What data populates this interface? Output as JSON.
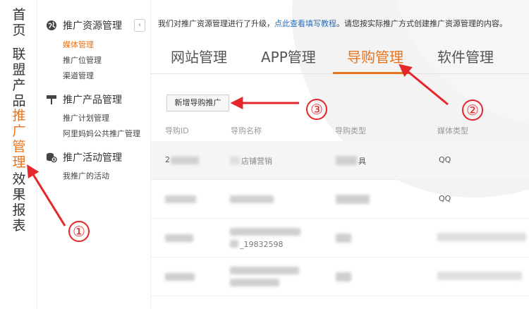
{
  "left_nav": {
    "items": [
      {
        "label": "首页",
        "active": false
      },
      {
        "label": "联盟产品",
        "active": false
      },
      {
        "label": "推广管理",
        "active": true
      },
      {
        "label": "效果报表",
        "active": false
      }
    ]
  },
  "sidebar": {
    "collapse_glyph": "‹",
    "groups": [
      {
        "icon": "globe-icon",
        "title": "推广资源管理",
        "items": [
          "媒体管理",
          "推广位管理",
          "渠道管理"
        ]
      },
      {
        "icon": "signpost-icon",
        "title": "推广产品管理",
        "items": [
          "推广计划管理",
          "阿里妈妈公共推广管理"
        ]
      },
      {
        "icon": "coins-icon",
        "title": "推广活动管理",
        "items": [
          "我推广的活动"
        ]
      }
    ]
  },
  "main": {
    "notice_prefix": "我们对推广资源管理进行了升级，",
    "notice_link": "点此查看填写教程",
    "notice_suffix": "。请您按实际推广方式创建推广资源管理的内容。",
    "tabs": [
      "网站管理",
      "APP管理",
      "导购管理",
      "软件管理"
    ],
    "active_tab": "导购管理",
    "add_button": "新增导购推广",
    "table": {
      "columns": [
        "导购ID",
        "导购名称",
        "导购类型",
        "媒体类型"
      ],
      "rows": [
        {
          "id": "2",
          "name": "店铺营销",
          "type": "具",
          "media": "QQ"
        },
        {
          "id": "",
          "name": "",
          "type": "",
          "media": "QQ"
        },
        {
          "id": "",
          "name": "_19832598",
          "type": "",
          "media": ""
        },
        {
          "id": "",
          "name": "",
          "type": "",
          "media": ""
        }
      ]
    }
  },
  "annotations": {
    "markers": [
      "①",
      "②",
      "③"
    ],
    "color": "#e5262a"
  },
  "colors": {
    "accent": "#e8731c",
    "link": "#2a6ebb",
    "annotation": "#e5262a"
  }
}
